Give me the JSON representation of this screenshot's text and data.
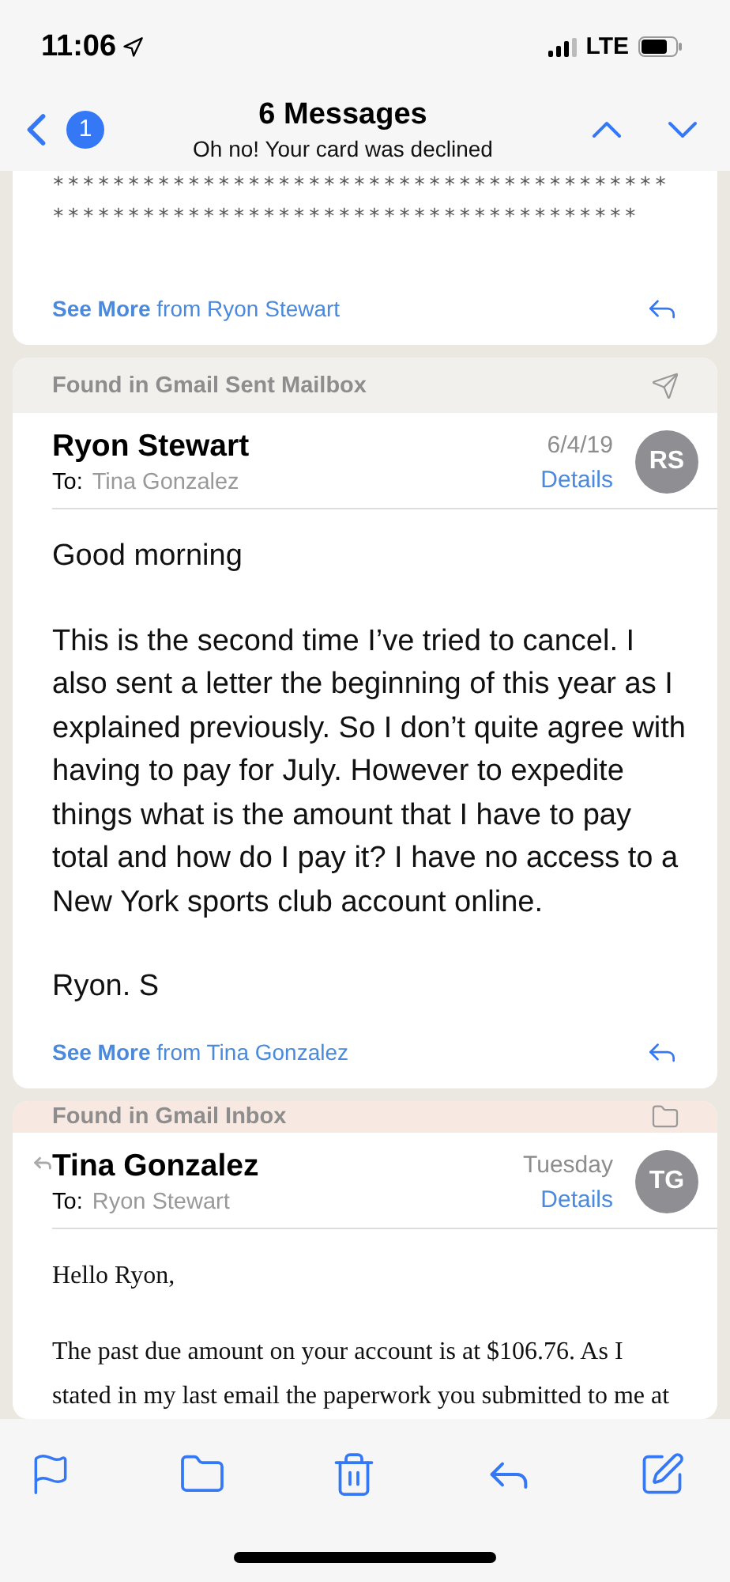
{
  "status_bar": {
    "time": "11:06",
    "network": "LTE"
  },
  "nav": {
    "badge": "1",
    "title": "6 Messages",
    "subtitle": "Oh no! Your card was declined"
  },
  "messages": [
    {
      "kind": "tail",
      "body": [
        "*****************************************",
        "***************************************"
      ],
      "see_more": "**See More** from Ryon Stewart"
    },
    {
      "kind": "sent",
      "found_in": "Found in Gmail Sent Mailbox",
      "replied": false,
      "sender": "Ryon Stewart",
      "to_label": "To:",
      "recipient": "Tina Gonzalez",
      "date": "6/4/19",
      "details": "Details",
      "avatar": "RS",
      "body": [
        "Good morning",
        "This is the second time I’ve tried to cancel. I also sent a letter the beginning of this year as I explained previously. So I don’t quite agree with having to pay for July. However to expedite things what is the amount that I have to pay total and how do I pay it? I have no access to a New York sports club account online.",
        "Ryon. S"
      ],
      "see_more": "**See More** from Tina Gonzalez"
    },
    {
      "kind": "received",
      "found_in": "Found in Gmail Inbox",
      "replied": true,
      "sender": "Tina Gonzalez",
      "to_label": "To:",
      "recipient": "Ryon Stewart",
      "date": "Tuesday",
      "details": "Details",
      "avatar": "TG",
      "body": [
        "Hello Ryon,",
        "The past due amount on your account is at $106.76. As I stated in my last email the paperwork you submitted to me at"
      ]
    }
  ]
}
